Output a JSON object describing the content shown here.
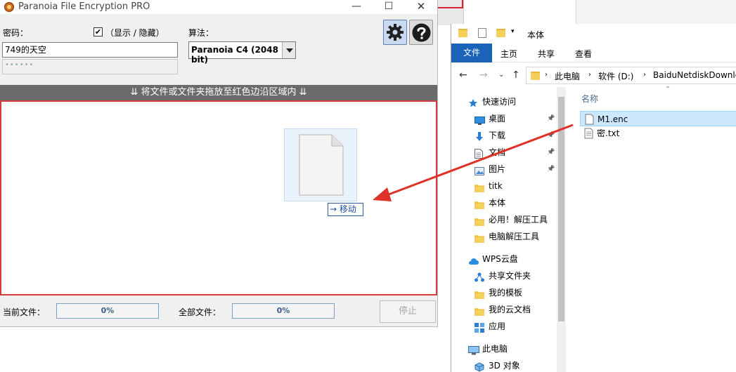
{
  "app": {
    "title": "Paranoia File Encryption PRO",
    "password_label": "密码：",
    "show_hide_label": "（显示 / 隐藏）",
    "show_checked": "✔",
    "algorithm_label": "算法：",
    "password_value": "749的天空",
    "password_mask": "••••••",
    "algorithm_value": "Paranoia C4 (2048 bit)",
    "drop_banner": "⇊ 将文件或文件夹拖放至红色边沿区域内 ⇊",
    "move_tip": "→ 移动",
    "current_file_label": "当前文件：",
    "current_progress": "0%",
    "all_files_label": "全部文件：",
    "all_progress": "0%",
    "stop_label": "停止",
    "window_min": "—",
    "window_max": "☐",
    "window_close": "✕"
  },
  "explorer": {
    "title": "本体",
    "ribbon_tabs": [
      "文件",
      "主页",
      "共享",
      "查看"
    ],
    "breadcrumb": [
      "此电脑",
      "软件 (D:)",
      "BaiduNetdiskDownload"
    ],
    "column_name": "名称",
    "files": [
      {
        "name": "M1.enc",
        "selected": true
      },
      {
        "name": "密.txt",
        "selected": false
      }
    ],
    "nav_items": [
      {
        "label": "快速访问",
        "icon": "star-icon",
        "pinned": false,
        "indent": 0
      },
      {
        "label": "桌面",
        "icon": "desktop-icon",
        "pinned": true,
        "indent": 1
      },
      {
        "label": "下载",
        "icon": "download-icon",
        "pinned": true,
        "indent": 1
      },
      {
        "label": "文档",
        "icon": "document-icon",
        "pinned": true,
        "indent": 1
      },
      {
        "label": "图片",
        "icon": "picture-icon",
        "pinned": true,
        "indent": 1
      },
      {
        "label": "titk",
        "icon": "folder-icon",
        "pinned": false,
        "indent": 1
      },
      {
        "label": "本体",
        "icon": "folder-icon",
        "pinned": false,
        "indent": 1
      },
      {
        "label": "必用！解压工具",
        "icon": "folder-icon",
        "pinned": false,
        "indent": 1
      },
      {
        "label": "电脑解压工具",
        "icon": "folder-icon",
        "pinned": false,
        "indent": 1
      },
      {
        "label": "WPS云盘",
        "icon": "cloud-icon",
        "pinned": false,
        "indent": 0
      },
      {
        "label": "共享文件夹",
        "icon": "share-icon",
        "pinned": false,
        "indent": 1
      },
      {
        "label": "我的模板",
        "icon": "folder-icon",
        "pinned": false,
        "indent": 1
      },
      {
        "label": "我的云文档",
        "icon": "folder-icon",
        "pinned": false,
        "indent": 1
      },
      {
        "label": "应用",
        "icon": "apps-icon",
        "pinned": false,
        "indent": 1
      },
      {
        "label": "此电脑",
        "icon": "computer-icon",
        "pinned": false,
        "indent": 0
      },
      {
        "label": "3D 对象",
        "icon": "3d-icon",
        "pinned": false,
        "indent": 1
      }
    ]
  },
  "colors": {
    "drop_border": "#d33a3a",
    "arrow": "#e0302a",
    "ribbon_active": "#1a63b8",
    "selection": "#cce8ff"
  }
}
